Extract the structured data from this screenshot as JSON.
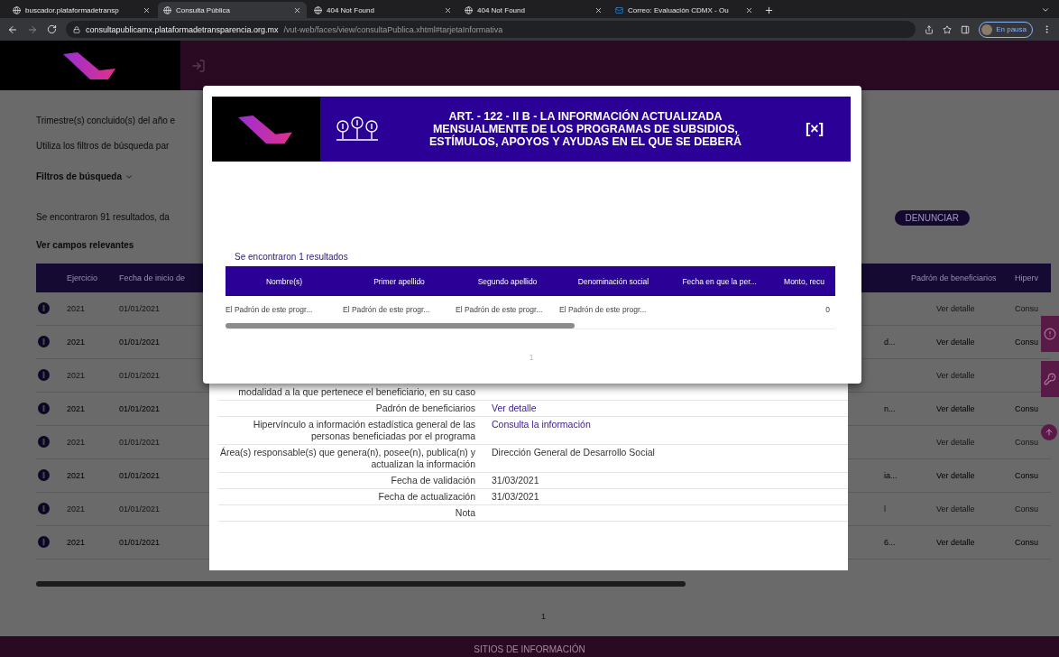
{
  "browser": {
    "tabs": [
      {
        "title": "buscador.plataformadetransp",
        "kind": "site",
        "selected": false
      },
      {
        "title": "Consulta Pública",
        "kind": "site",
        "selected": true
      },
      {
        "title": "404 Not Found",
        "kind": "site",
        "selected": false
      },
      {
        "title": "404 Not Found",
        "kind": "site",
        "selected": false
      },
      {
        "title": "Correo: Evaluación CDMX - Ou",
        "kind": "mail",
        "selected": false
      }
    ],
    "host": "consultapublicamx.plataformadetransparencia.org.mx",
    "path": "/vut-web/faces/view/consultaPublica.xhtml#tarjetaInformativa",
    "profile": "En pausa"
  },
  "page": {
    "intro": [
      "Trimestre(s) concluido(s) del año e",
      "Utiliza los filtros de búsqueda par"
    ],
    "filters": "Filtros de búsqueda",
    "summary": "Se encontraron 91 resultados, da",
    "relevant_link": "Ver campos relevantes",
    "report_button": "DENUNCIAR",
    "table": {
      "columns": [
        "Ejercicio",
        "Fecha de inicio de",
        "Padrón de beneficiarios",
        "Hiperv"
      ],
      "rows": [
        {
          "year": "2021",
          "start": "01/01/2021",
          "column_4": "",
          "beneficiaries": "Ver detalle",
          "column_6": "Consu"
        },
        {
          "year": "2021",
          "start": "01/01/2021",
          "column_4": "d...",
          "beneficiaries": "Ver detalle",
          "column_6": "Consu"
        },
        {
          "year": "2021",
          "start": "01/01/2021",
          "column_4": "",
          "beneficiaries": "Ver detalle",
          "column_6": ""
        },
        {
          "year": "2021",
          "start": "01/01/2021",
          "column_4": "n...",
          "beneficiaries": "Ver detalle",
          "column_6": "Consu"
        },
        {
          "year": "2021",
          "start": "01/01/2021",
          "column_4": "",
          "beneficiaries": "Ver detalle",
          "column_6": "Consu"
        },
        {
          "year": "2021",
          "start": "01/01/2021",
          "column_4": "ia...",
          "beneficiaries": "Ver detalle",
          "column_6": "Consu"
        },
        {
          "year": "2021",
          "start": "01/01/2021",
          "column_4": "l",
          "beneficiaries": "Ver detalle",
          "column_6": "Consu"
        },
        {
          "year": "2021",
          "start": "01/01/2021",
          "column_4": "6...",
          "beneficiaries": "Ver detalle",
          "column_6": "Consu"
        }
      ]
    },
    "pagination": "1",
    "footer": "SITIOS DE INFORMACIÓN"
  },
  "detail_panel": {
    "rows": [
      {
        "label": "modalidad a la que pertenece el beneficiario, en su caso",
        "kind": "text"
      },
      {
        "label": "Padrón de beneficiarios",
        "value": "Ver detalle",
        "kind": "link"
      },
      {
        "label": "Hipervínculo a información estadística general de las personas beneficiadas por el programa",
        "value": "Consulta la información",
        "kind": "link"
      },
      {
        "label": "Área(s) responsable(s) que genera(n), posee(n), publica(n) y actualizan la información",
        "value": "Dirección General de Desarrollo Social",
        "kind": "text"
      },
      {
        "label": "Fecha de validación",
        "value": "31/03/2021",
        "kind": "text"
      },
      {
        "label": "Fecha de actualización",
        "value": "31/03/2021",
        "kind": "text"
      },
      {
        "label": "Nota",
        "kind": "text"
      }
    ]
  },
  "modal": {
    "title": [
      "ART. - 122 - II B - LA INFORMACIÓN ACTUALIZADA",
      "MENSUALMENTE DE LOS PROGRAMAS DE SUBSIDIOS,",
      "ESTÍMULOS, APOYOS Y AYUDAS EN EL QUE SE DEBERÁ"
    ],
    "close": "[×]",
    "results": "Se encontraron 1 resultados",
    "columns": [
      "Nombre(s)",
      "Primer apellido",
      "Segundo apellido",
      "Denominación social",
      "Fecha en que la per...",
      "Monto, recu"
    ],
    "rows": [
      {
        "cells": [
          "El Padrón de este progr...",
          "El Padrón de este progr...",
          "El Padrón de este progr...",
          "El Padrón de este progr...",
          "",
          "0"
        ]
      }
    ],
    "pagination": "1"
  }
}
